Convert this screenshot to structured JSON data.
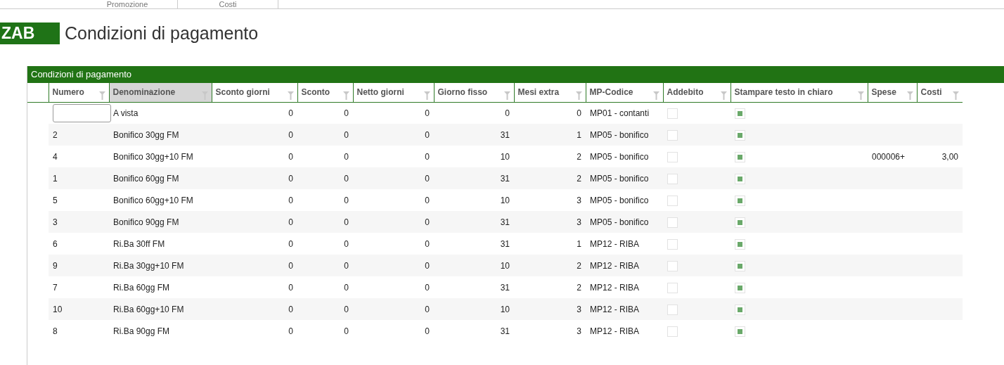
{
  "tabs": [
    {
      "label": "Promozione",
      "selected": false
    },
    {
      "label": "Costi",
      "selected": false
    }
  ],
  "badge": "ZAB",
  "title": "Condizioni di pagamento",
  "grid": {
    "title": "Condizioni di pagamento",
    "columns": [
      {
        "label": "Numero",
        "sorted": false
      },
      {
        "label": "Denominazione",
        "sorted": true
      },
      {
        "label": "Sconto giorni",
        "sorted": false
      },
      {
        "label": "Sconto",
        "sorted": false
      },
      {
        "label": "Netto giorni",
        "sorted": false
      },
      {
        "label": "Giorno fisso",
        "sorted": false
      },
      {
        "label": "Mesi extra",
        "sorted": false
      },
      {
        "label": "MP-Codice",
        "sorted": false
      },
      {
        "label": "Addebito",
        "sorted": false
      },
      {
        "label": "Stampare testo in chiaro",
        "sorted": false
      },
      {
        "label": "Spese",
        "sorted": false
      },
      {
        "label": "Costi",
        "sorted": false
      }
    ],
    "rows": [
      {
        "editing": true,
        "denominazione": "A vista",
        "sconto_giorni": "0",
        "sconto": "0",
        "netto_giorni": "0",
        "giorno_fisso": "0",
        "mesi_extra": "0",
        "mp_codice": "MP01 - contanti",
        "addebito": false,
        "stampare": true
      },
      {
        "editing": false,
        "numero": "2",
        "denominazione": "Bonifico 30gg FM",
        "sconto_giorni": "0",
        "sconto": "0",
        "netto_giorni": "0",
        "giorno_fisso": "31",
        "mesi_extra": "1",
        "mp_codice": "MP05 - bonifico",
        "addebito": false,
        "stampare": true
      },
      {
        "editing": false,
        "numero": "4",
        "denominazione": "Bonifico 30gg+10 FM",
        "sconto_giorni": "0",
        "sconto": "0",
        "netto_giorni": "0",
        "giorno_fisso": "10",
        "mesi_extra": "2",
        "mp_codice": "MP05 - bonifico",
        "addebito": false,
        "stampare": true,
        "spese": "000006+",
        "costi": "3,00"
      },
      {
        "editing": false,
        "numero": "1",
        "denominazione": "Bonifico 60gg FM",
        "sconto_giorni": "0",
        "sconto": "0",
        "netto_giorni": "0",
        "giorno_fisso": "31",
        "mesi_extra": "2",
        "mp_codice": "MP05 - bonifico",
        "addebito": false,
        "stampare": true
      },
      {
        "editing": false,
        "numero": "5",
        "denominazione": "Bonifico 60gg+10 FM",
        "sconto_giorni": "0",
        "sconto": "0",
        "netto_giorni": "0",
        "giorno_fisso": "10",
        "mesi_extra": "3",
        "mp_codice": "MP05 - bonifico",
        "addebito": false,
        "stampare": true
      },
      {
        "editing": false,
        "numero": "3",
        "denominazione": "Bonifico 90gg FM",
        "sconto_giorni": "0",
        "sconto": "0",
        "netto_giorni": "0",
        "giorno_fisso": "31",
        "mesi_extra": "3",
        "mp_codice": "MP05 - bonifico",
        "addebito": false,
        "stampare": true
      },
      {
        "editing": false,
        "numero": "6",
        "denominazione": "Ri.Ba 30ff FM",
        "sconto_giorni": "0",
        "sconto": "0",
        "netto_giorni": "0",
        "giorno_fisso": "31",
        "mesi_extra": "1",
        "mp_codice": "MP12 - RIBA",
        "addebito": false,
        "stampare": true
      },
      {
        "editing": false,
        "numero": "9",
        "denominazione": "Ri.Ba 30gg+10 FM",
        "sconto_giorni": "0",
        "sconto": "0",
        "netto_giorni": "0",
        "giorno_fisso": "10",
        "mesi_extra": "2",
        "mp_codice": "MP12 - RIBA",
        "addebito": false,
        "stampare": true
      },
      {
        "editing": false,
        "numero": "7",
        "denominazione": "Ri.Ba 60gg FM",
        "sconto_giorni": "0",
        "sconto": "0",
        "netto_giorni": "0",
        "giorno_fisso": "31",
        "mesi_extra": "2",
        "mp_codice": "MP12 - RIBA",
        "addebito": false,
        "stampare": true
      },
      {
        "editing": false,
        "numero": "10",
        "denominazione": "Ri.Ba 60gg+10 FM",
        "sconto_giorni": "0",
        "sconto": "0",
        "netto_giorni": "0",
        "giorno_fisso": "10",
        "mesi_extra": "3",
        "mp_codice": "MP12 - RIBA",
        "addebito": false,
        "stampare": true
      },
      {
        "editing": false,
        "numero": "8",
        "denominazione": "Ri.Ba 90gg FM",
        "sconto_giorni": "0",
        "sconto": "0",
        "netto_giorni": "0",
        "giorno_fisso": "31",
        "mesi_extra": "3",
        "mp_codice": "MP12 - RIBA",
        "addebito": false,
        "stampare": true
      }
    ]
  }
}
